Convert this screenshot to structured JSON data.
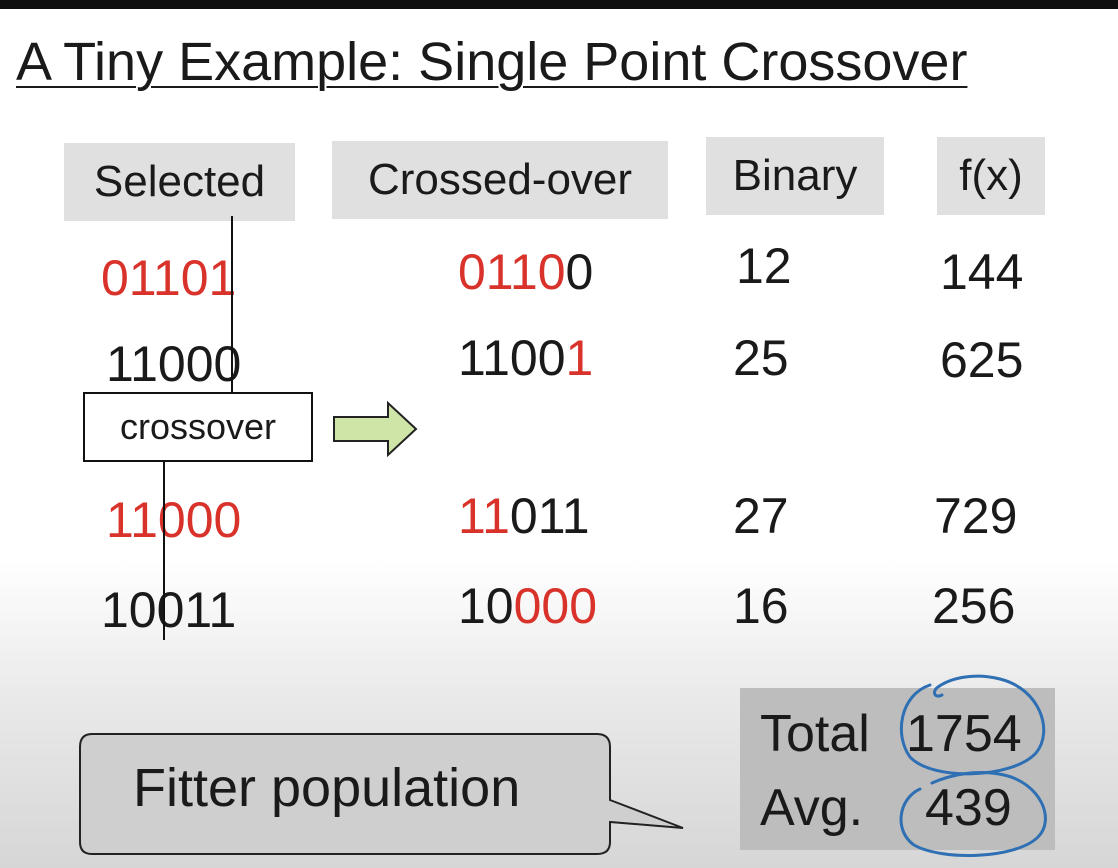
{
  "slide": {
    "title": "A Tiny Example: Single Point Crossover"
  },
  "headers": {
    "selected": "Selected",
    "crossed_over": "Crossed-over",
    "binary": "Binary",
    "fx": "f(x)"
  },
  "operator_label": "crossover",
  "rows": [
    {
      "selected_red": "0110",
      "selected_black": "",
      "selected_red2": "1",
      "crossed_red": "0110",
      "crossed_black": "0",
      "binary": "12",
      "fx": "144"
    },
    {
      "selected_black": "11000",
      "crossed_black": "1100",
      "crossed_red": "1",
      "binary": "25",
      "fx": "625"
    },
    {
      "selected_red": "11000",
      "crossed_red": "11",
      "crossed_black": "011",
      "binary": "27",
      "fx": "729"
    },
    {
      "selected_black": "10011",
      "crossed_black": "10",
      "crossed_red": "000",
      "binary": "16",
      "fx": "256"
    }
  ],
  "callout": {
    "text": "Fitter population"
  },
  "summary": {
    "total_label": "Total",
    "total_value": "1754",
    "avg_label": "Avg.",
    "avg_value": "439"
  },
  "colors": {
    "highlight_red": "#d8322a",
    "header_bg": "#e0e0e0",
    "arrow_fill": "#cfe5a8",
    "circle_stroke": "#2f6fb3",
    "callout_fill": "#cfcfcf"
  }
}
